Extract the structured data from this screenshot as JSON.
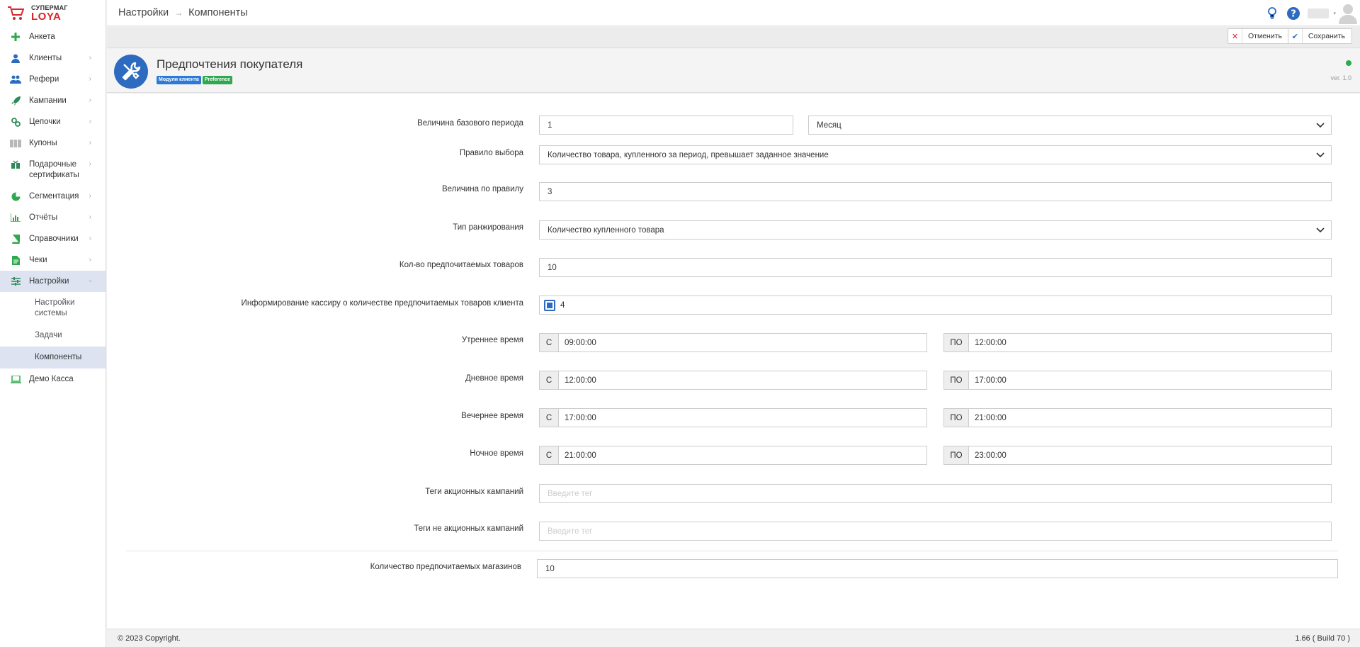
{
  "logo": {
    "line1": "СУПЕРМАГ",
    "line2": "LOYA"
  },
  "breadcrumb": {
    "items": [
      "Настройки",
      "Компоненты"
    ]
  },
  "sidebar": {
    "items": [
      {
        "label": "Анкета",
        "icon": "plus-icon",
        "chevron": false
      },
      {
        "label": "Клиенты",
        "icon": "user-icon",
        "chevron": true
      },
      {
        "label": "Рефери",
        "icon": "users-icon",
        "chevron": true
      },
      {
        "label": "Кампании",
        "icon": "rocket-icon",
        "chevron": true
      },
      {
        "label": "Цепочки",
        "icon": "chain-icon",
        "chevron": true
      },
      {
        "label": "Купоны",
        "icon": "barcode-icon",
        "chevron": true
      },
      {
        "label": "Подарочные сертификаты",
        "icon": "gift-icon",
        "chevron": true
      },
      {
        "label": "Сегментация",
        "icon": "pie-chart-icon",
        "chevron": true
      },
      {
        "label": "Отчёты",
        "icon": "bar-chart-icon",
        "chevron": true
      },
      {
        "label": "Справочники",
        "icon": "book-icon",
        "chevron": true
      },
      {
        "label": "Чеки",
        "icon": "receipt-icon",
        "chevron": true
      },
      {
        "label": "Настройки",
        "icon": "sliders-icon",
        "chevron": true
      }
    ],
    "subitems": [
      "Настройки системы",
      "Задачи",
      "Компоненты"
    ],
    "last_item": {
      "label": "Демо Касса",
      "icon": "laptop-icon"
    }
  },
  "toolbar": {
    "cancel_label": "Отменить",
    "save_label": "Сохранить"
  },
  "header": {
    "title": "Предпочтения покупателя",
    "badge_module": "Модули клиента",
    "badge_tag": "Preference",
    "version": "ver. 1.0"
  },
  "form": {
    "base_period": {
      "label": "Величина базового периода",
      "value": "1",
      "unit": "Месяц"
    },
    "rule": {
      "label": "Правило выбора",
      "value": "Количество товара, купленного за период, превышает заданное значение"
    },
    "rule_value": {
      "label": "Величина по правилу",
      "value": "3"
    },
    "ranking": {
      "label": "Тип ранжирования",
      "value": "Количество купленного товара"
    },
    "pref_count": {
      "label": "Кол-во предпочитаемых товаров",
      "value": "10"
    },
    "cashier_info": {
      "label": "Информирование кассиру о количестве предпочитаемых товаров клиента",
      "value": "4",
      "checked": true
    },
    "from_label": "С",
    "to_label": "ПО",
    "times": [
      {
        "label": "Утреннее время",
        "from": "09:00:00",
        "to": "12:00:00"
      },
      {
        "label": "Дневное время",
        "from": "12:00:00",
        "to": "17:00:00"
      },
      {
        "label": "Вечернее время",
        "from": "17:00:00",
        "to": "21:00:00"
      },
      {
        "label": "Ночное время",
        "from": "21:00:00",
        "to": "23:00:00"
      }
    ],
    "promo_tags": {
      "label": "Теги акционных кампаний",
      "placeholder": "Введите тег"
    },
    "nonpromo_tags": {
      "label": "Теги не акционных кампаний",
      "placeholder": "Введите тег"
    },
    "pref_stores": {
      "label": "Количество предпочитаемых магазинов",
      "value": "10"
    }
  },
  "footer": {
    "copyright": "© 2023 Copyright.",
    "build": "1.66 ( Build 70 )"
  },
  "colors": {
    "accent": "#2c6bc0",
    "active_bg": "#dde3f1",
    "sidebar_icon": "#2fa84f",
    "status": "#2da94f",
    "danger": "#d8252d"
  }
}
